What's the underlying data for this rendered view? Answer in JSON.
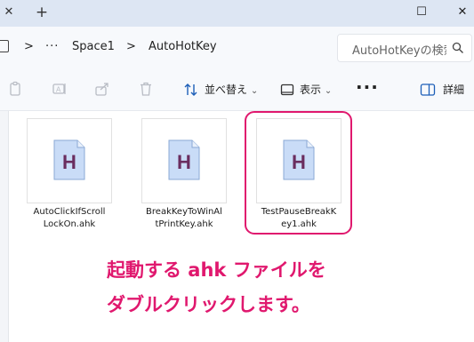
{
  "window": {
    "tab_close_glyph": "✕",
    "tab_add_glyph": "+",
    "maximize_glyph": "☐",
    "close_glyph": "✕"
  },
  "address_bar": {
    "separator": ">",
    "overflow": "···",
    "crumbs": [
      "Space1",
      "AutoHotKey"
    ],
    "search_placeholder": "AutoHotKeyの検索"
  },
  "command_bar": {
    "sort_label": "並べ替え",
    "sort_chevron": "⌄",
    "view_label": "表示",
    "view_chevron": "⌄",
    "more_label": "···",
    "details_label": "詳細"
  },
  "files": [
    {
      "name": "AutoClickIfScrollLockOn.ahk",
      "line1": "AutoClickIfScroll",
      "line2": "LockOn.ahk",
      "icon_letter": "H"
    },
    {
      "name": "BreakKeyToWinAltPrintKey.ahk",
      "line1": "BreakKeyToWinAl",
      "line2": "tPrintKey.ahk",
      "icon_letter": "H"
    },
    {
      "name": "TestPauseBreakKey1.ahk",
      "line1": "TestPauseBreakK",
      "line2": "ey1.ahk",
      "icon_letter": "H"
    }
  ],
  "instruction": {
    "line1": "起動する ahk ファイルを",
    "line2": "ダブルクリックします。",
    "color": "#e0186e"
  }
}
